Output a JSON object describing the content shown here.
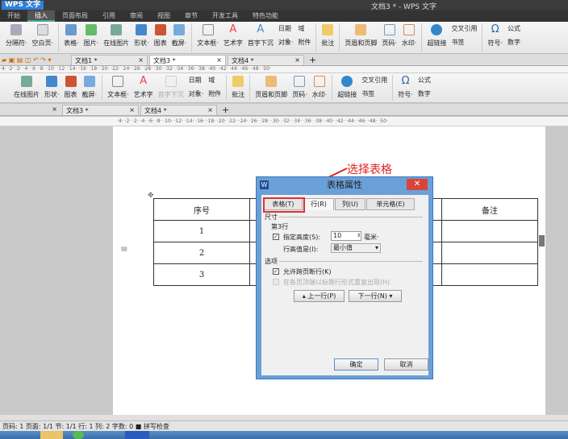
{
  "app": {
    "button": "WPS 文字",
    "title": "文档3 * - WPS 文字"
  },
  "menu": [
    "开始",
    "插入",
    "页面布局",
    "引用",
    "审阅",
    "视图",
    "章节",
    "开发工具",
    "特色功能"
  ],
  "ribbon": {
    "large": [
      "分隔符·",
      "空白页·",
      "表格·",
      "图片·",
      "在线图片",
      "形状·",
      "图表",
      "截屏·",
      "文本框·",
      "艺术字",
      "首字下沉"
    ],
    "small1": [
      "日期",
      "域"
    ],
    "small2": [
      "对象·",
      "附件"
    ],
    "large2": [
      "批注",
      "页眉和页脚",
      "页码·",
      "水印·",
      "超链接"
    ],
    "small3": [
      "交叉引用",
      "书签"
    ],
    "sym": "符号·",
    "formula": "公式",
    "number": "数字"
  },
  "ribbon2": {
    "large": [
      "在线图片",
      "形状·",
      "图表",
      "截屏·",
      "文本框·",
      "艺术字",
      "首字下沉"
    ],
    "small1": [
      "日期",
      "域"
    ],
    "small2": [
      "对象·",
      "附件"
    ],
    "large2": [
      "批注",
      "页眉和页脚",
      "页码·",
      "水印·",
      "超链接"
    ],
    "small3": [
      "交叉引用",
      "书签"
    ],
    "sym": "符号·",
    "formula": "公式",
    "number": "数字"
  },
  "tabs1": [
    "文档1 *",
    "文档3 *",
    "文档4 *"
  ],
  "tabs2": [
    "文档3 *",
    "文档4 *"
  ],
  "ruler": "·4· ·2· ·2· ·4· ·6· ·8· ·10· ·12· ·14· ·16· ·18· ·20· ·22· ·24· ·26· ·28· ·30· ·32· ·34· ·36· ·38· ·40· ·42· ·44· ·46· ·48· ·50·",
  "table": {
    "rows": [
      [
        "序号",
        "",
        "",
        "备注"
      ],
      [
        "1",
        "",
        "",
        ""
      ],
      [
        "2",
        "",
        "",
        ""
      ],
      [
        "3",
        "",
        "",
        ""
      ]
    ]
  },
  "annotation": "选择表格",
  "dialog": {
    "title": "表格属性",
    "tabs": [
      "表格(T)",
      "行(R)",
      "列(U)",
      "单元格(E)"
    ],
    "section_size": "尺寸",
    "row_label": "第3行",
    "specify_height": "指定高度(S):",
    "height_value": "10",
    "unit": "毫米·",
    "height_rule_label": "行高值是(I):",
    "height_rule": "最小值",
    "section_options": "选项",
    "allow_break": "允许跨页断行(K)",
    "repeat_header": "在各页顶端以标题行形式重复出现(H)",
    "prev_row": "▴ 上一行(P)",
    "next_row": "下一行(N) ▾",
    "ok": "确定",
    "cancel": "取消",
    "close": "✕"
  },
  "status": "页码: 1  页面: 1/1  节: 1/1  行: 1  列: 2  字数: 0  ■ 拼写检查",
  "colors": {
    "accent": "#2f7fd8",
    "annotation": "#e02020",
    "dialog_frame": "#6aa0d8"
  }
}
